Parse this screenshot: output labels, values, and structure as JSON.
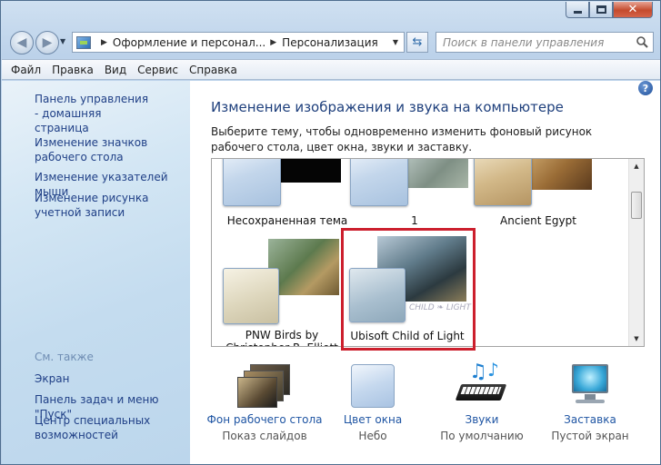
{
  "window": {
    "address_path": [
      "Оформление и персонал...",
      "Персонализация"
    ],
    "search_placeholder": "Поиск в панели управления"
  },
  "menu": [
    "Файл",
    "Правка",
    "Вид",
    "Сервис",
    "Справка"
  ],
  "sidebar": {
    "links": [
      "Панель управления - домашняя страница",
      "Изменение значков рабочего стола",
      "Изменение указателей мыши",
      "Изменение рисунка учетной записи"
    ],
    "see_also_title": "См. также",
    "see_also": [
      "Экран",
      "Панель задач и меню \"Пуск\"",
      "Центр специальных возможностей"
    ]
  },
  "main": {
    "title": "Изменение изображения и звука на компьютере",
    "description": "Выберите тему, чтобы одновременно изменить фоновый рисунок рабочего стола, цвет окна, звуки и заставку.",
    "themes": [
      {
        "label": "Несохраненная тема"
      },
      {
        "label": "1"
      },
      {
        "label": "Ancient Egypt"
      },
      {
        "label": "PNW Birds by Christopher R. Elliott"
      },
      {
        "label": "Ubisoft Child of Light",
        "selected": true,
        "thumb_text": "CHILD ❧ LIGHT"
      }
    ],
    "bottom": [
      {
        "title": "Фон рабочего стола",
        "sub": "Показ слайдов",
        "icon": "desktop-background-icon"
      },
      {
        "title": "Цвет окна",
        "sub": "Небо",
        "icon": "window-color-icon"
      },
      {
        "title": "Звуки",
        "sub": "По умолчанию",
        "icon": "sounds-icon"
      },
      {
        "title": "Заставка",
        "sub": "Пустой экран",
        "icon": "screensaver-icon"
      }
    ]
  },
  "colors": {
    "selection_border": "#cc1f2d",
    "link": "#1f3f86",
    "title": "#1e3f7c"
  }
}
